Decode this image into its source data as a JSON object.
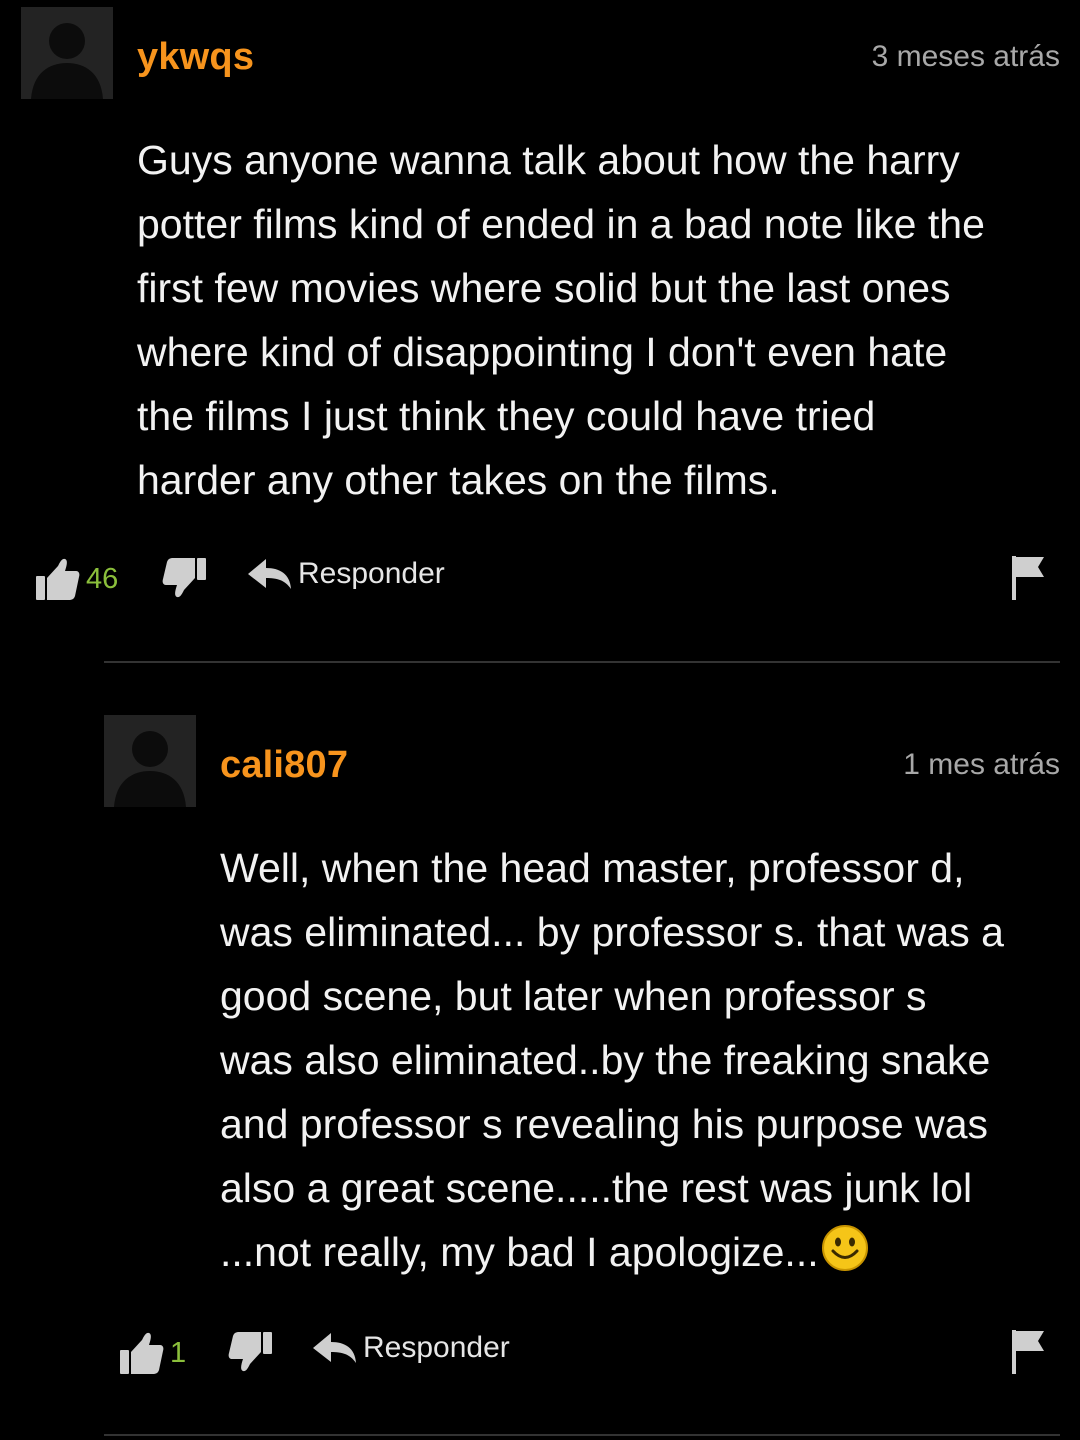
{
  "comments": [
    {
      "username": "ykwqs",
      "time": "3 meses atrás",
      "lines": [
        "Guys anyone wanna talk about how the harry",
        "potter films kind of ended in a bad note like the",
        "first few movies where solid but the last ones",
        "where kind of disappointing I don't even hate",
        "the films I just think they could have tried",
        "harder any other takes on the films."
      ],
      "likes": "46",
      "reply_label": "Responder"
    },
    {
      "username": "cali807",
      "time": "1 mes atrás",
      "lines": [
        "Well, when the head master, professor d,",
        "was eliminated... by professor s. that was a",
        "good scene, but later when professor s",
        "was also eliminated..by the freaking snake",
        "and professor s revealing his purpose was",
        "also a great scene.....the rest was junk lol",
        "...not really, my bad I apologize..."
      ],
      "likes": "1",
      "reply_label": "Responder"
    }
  ],
  "icons": {
    "avatar": "default-avatar-icon",
    "like": "thumbs-up-icon",
    "dislike": "thumbs-down-icon",
    "reply": "reply-arrow-icon",
    "flag": "flag-icon",
    "emoji": "smiley-icon"
  },
  "colors": {
    "background": "#000000",
    "username": "#f7941d",
    "likes_count": "#8bbf3b",
    "timestamp": "#a8a8a8"
  }
}
